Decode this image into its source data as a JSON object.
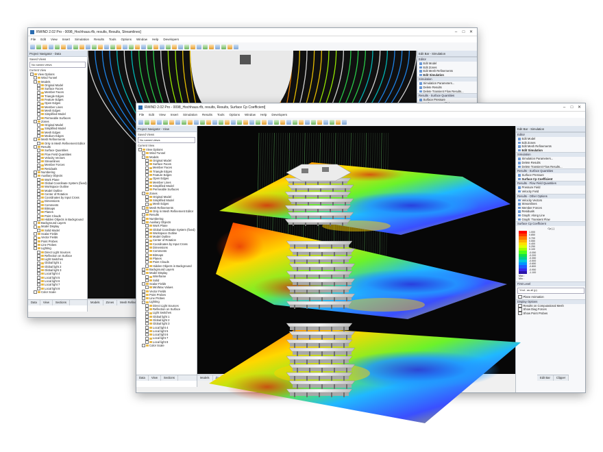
{
  "back_window": {
    "title": "RWIND 2.02 Pro - 0098_Hochhaus.rfb, results, Results, Streamlines]",
    "menu": [
      "File",
      "Edit",
      "View",
      "Insert",
      "Simulation",
      "Results",
      "Tools",
      "Options",
      "Window",
      "Help",
      "Developers"
    ],
    "navigator_title": "Project Navigator - Data",
    "saved_views_label": "Saved Views",
    "saved_views_value": "No named views",
    "current_view_label": "Current View",
    "tree": [
      "View Options",
      "Wind Tunnel",
      "Models",
      "Original Model",
      "Surface Faces",
      "Member Faces",
      "Triangle Edges",
      "Feature Edges",
      "Open Edges",
      "Member Lines",
      "Mesh Edges",
      "Simplified Model",
      "Permeable Surfaces",
      "Zones",
      "Original Model",
      "Simplified Model",
      "Mesh Edges",
      "Medium Edges",
      "Mesh Refinements",
      "Only in Mesh Refinement Editor",
      "Results",
      "Surface Quantities",
      "Flow Field Quantities",
      "Velocity Vectors",
      "Streamlines",
      "Member Forces",
      "Residuals",
      "Numbering",
      "Auxiliary Objects",
      "Work Plane",
      "Global Coordinate System (fixed)",
      "Workspace Outline",
      "Model Outline",
      "Center of Rotation",
      "Coordinates by Input Cross",
      "Dimensions",
      "Comments",
      "Bitmaps",
      "Planes",
      "Point Clouds",
      "Hidden Objects in Background",
      "Background Layers",
      "Model Display",
      "Solid Model",
      "Scalar Fields",
      "Vector Fields",
      "Point Probes",
      "Line Probes",
      "Lighting",
      "Direct Light Sources",
      "Reflection on Surface",
      "Light Switches",
      "Global light 1",
      "Global light 2",
      "Global light 3",
      "Local light 4",
      "Local light 5",
      "Local light 6",
      "Local light 7",
      "Local light 8",
      "Color Scale"
    ],
    "bottom_tabs": [
      "Data",
      "View",
      "Sections"
    ],
    "view_tabs": [
      "Models",
      "Zones",
      "Mesh Refinements"
    ],
    "editbar_title": "Edit Bar - Simulation",
    "editbar_sections": [
      {
        "title": "Editor",
        "items": [
          "Edit Model",
          "Edit Zones",
          "Edit Mesh Refinements",
          "Edit Simulation"
        ]
      },
      {
        "title": "Simulation",
        "items": [
          "Simulation Parameters...",
          "Delete Results",
          "Delete Transient Flow Results..."
        ]
      },
      {
        "title": "Results - Surface Quantities",
        "items": [
          "Surface Pressure",
          "Surface Cp Coefficient"
        ]
      },
      {
        "title": "Results - Flow Field Quantities",
        "items": []
      }
    ]
  },
  "front_window": {
    "title": "RWIND 2.02 Pro - 0098_Hochhaus.rfb, results, Results, Surface Cp Coefficient]",
    "menu": [
      "File",
      "Edit",
      "View",
      "Insert",
      "Simulation",
      "Results",
      "Tools",
      "Options",
      "Window",
      "Help",
      "Developers"
    ],
    "navigator_title": "Project Navigator - View",
    "saved_views_label": "Saved Views",
    "saved_views_value": "No named views",
    "current_view_label": "Current View",
    "tree": [
      "View Options",
      "Wind Tunnel",
      "Models",
      "Original Model",
      "Surface Faces",
      "Member Faces",
      "Triangle Edges",
      "Feature Edges",
      "Open Edges",
      "Member Lines",
      "Simplified Model",
      "Permeable Surfaces",
      "Zones",
      "Original Model",
      "Simplified Model",
      "Mesh Edges",
      "Mesh Refinements",
      "Only in Mesh Refinement Editor",
      "Results",
      "Numbering",
      "Auxiliary Objects",
      "Work Plane",
      "Global Coordinate System (fixed)",
      "Workspace Outline",
      "Model Outline",
      "Center of Rotation",
      "Coordinates by Input Cross",
      "Dimensions",
      "Comments",
      "Bitmaps",
      "Planes",
      "Point Clouds",
      "Hidden Objects in Background",
      "Background Layers",
      "Model Display",
      "Wireframe",
      "Solid",
      "Scalar Fields",
      "Min/Max Values",
      "Vector Fields",
      "Point Probes",
      "Line Probes",
      "Lighting",
      "Direct Light Sources",
      "Reflection on Surface",
      "Light Switches",
      "Global light 1",
      "Global light 2",
      "Global light 3",
      "Local light 4",
      "Local light 5",
      "Local light 6",
      "Local light 7",
      "Local light 8",
      "Color Scale"
    ],
    "bottom_tabs": [
      "Data",
      "View",
      "Sections"
    ],
    "view_tabs": [
      "Models",
      "Zones",
      "Mesh Refinements",
      "Simulation"
    ],
    "editbar_title": "Edit Bar - Simulation",
    "editbar_sections": [
      {
        "title": "Editor",
        "items": [
          "Edit Model",
          "Edit Zones",
          "Edit Mesh Refinements",
          "Edit Simulation"
        ]
      },
      {
        "title": "Simulation",
        "items": [
          "Simulation Parameters...",
          "Delete Results",
          "Delete Transient Flow Results..."
        ]
      },
      {
        "title": "Results - Surface Quantities",
        "items": [
          "Surface Pressure",
          "Surface Cp Coefficient"
        ]
      },
      {
        "title": "Results - Flow Field Quantities",
        "items": [
          "Pressure Field",
          "Velocity Field"
        ]
      },
      {
        "title": "Results - Other Options",
        "items": [
          "Velocity Vectors",
          "Streamlines",
          "Member Forces",
          "Residuals",
          "Graph: Along Line",
          "Graph: Transient Flow"
        ]
      }
    ],
    "legend_title": "Surface Cp Coefficient",
    "legend_subtitle": "Cp [-]",
    "legend_values": [
      "1.000",
      "0.850",
      "0.700",
      "0.550",
      "0.400",
      "0.250",
      "0.100",
      "-0.050",
      "-0.200",
      "-0.350",
      "-0.500",
      "-0.650",
      "-0.800",
      "-0.950",
      "-1.100"
    ],
    "legend_colors": [
      "#ff0000",
      "#ff3a00",
      "#ff7a00",
      "#ffb000",
      "#ffe000",
      "#e0ff00",
      "#9eff00",
      "#4cff1a",
      "#14e04a",
      "#00d08e",
      "#00c8d8",
      "#0096ff",
      "#1e5aff",
      "#3a28e8",
      "#2a14a8"
    ],
    "legend_max_label": "Max :",
    "legend_min_label": "Min :",
    "first_level_label": "First Level",
    "first_level_value": "Ymd - as all (p)",
    "plane_animation_label": "Plane Animation",
    "display_options_label": "Display Options",
    "display_options": [
      "Results on Computational Mesh",
      "Show Diag Forces",
      "Show Point Probes"
    ],
    "editbar_tabs": [
      "Edit Bar",
      "Clipper"
    ]
  }
}
